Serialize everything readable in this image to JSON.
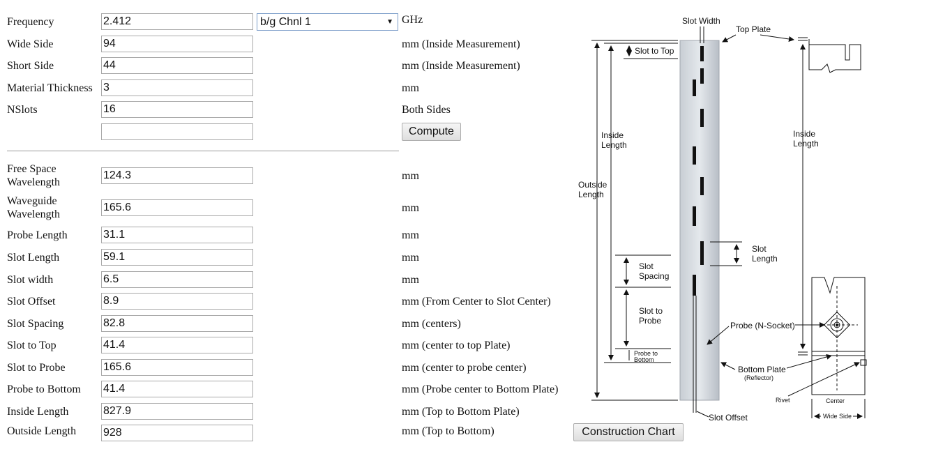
{
  "form": {
    "frequency": {
      "label": "Frequency",
      "value": "2.412",
      "unit": "GHz"
    },
    "channel_select": {
      "value": "b/g Chnl 1"
    },
    "wide_side": {
      "label": "Wide Side",
      "value": "94",
      "unit": "mm (Inside Measurement)"
    },
    "short_side": {
      "label": "Short Side",
      "value": "44",
      "unit": "mm (Inside Measurement)"
    },
    "material_thickness": {
      "label": "Material Thickness",
      "value": "3",
      "unit": "mm"
    },
    "nslots": {
      "label": "NSlots",
      "value": "16",
      "unit": "Both Sides"
    },
    "extra_field": {
      "value": ""
    },
    "compute_label": "Compute"
  },
  "results": [
    {
      "label_line1": "Free Space",
      "label_line2": "Wavelength",
      "value": "124.3",
      "unit": "mm"
    },
    {
      "label_line1": "Waveguide",
      "label_line2": "Wavelength",
      "value": "165.6",
      "unit": "mm"
    },
    {
      "label_line1": "Probe Length",
      "label_line2": "",
      "value": "31.1",
      "unit": "mm"
    },
    {
      "label_line1": "Slot Length",
      "label_line2": "",
      "value": "59.1",
      "unit": "mm"
    },
    {
      "label_line1": "Slot width",
      "label_line2": "",
      "value": "6.5",
      "unit": "mm"
    },
    {
      "label_line1": "Slot Offset",
      "label_line2": "",
      "value": "8.9",
      "unit": "mm (From Center to Slot Center)"
    },
    {
      "label_line1": "Slot Spacing",
      "label_line2": "",
      "value": "82.8",
      "unit": "mm (centers)"
    },
    {
      "label_line1": "Slot to Top",
      "label_line2": "",
      "value": "41.4",
      "unit": "mm (center to top Plate)"
    },
    {
      "label_line1": "Slot to Probe",
      "label_line2": "",
      "value": "165.6",
      "unit": "mm (center to probe center)"
    },
    {
      "label_line1": "Probe to Bottom",
      "label_line2": "",
      "value": "41.4",
      "unit": "mm (Probe center to Bottom Plate)"
    },
    {
      "label_line1": "Inside Length",
      "label_line2": "",
      "value": "827.9",
      "unit": "mm (Top to Bottom Plate)"
    },
    {
      "label_line1": "Outside Length",
      "label_line2": "",
      "value": "928",
      "unit": "mm (Top to Bottom)"
    }
  ],
  "diagram": {
    "slot_width": "Slot Width",
    "top_plate": "Top Plate",
    "slot_to_top": "Slot to Top",
    "inside_length_1": "Inside",
    "inside_length_2": "Length",
    "outside_length_1": "Outside",
    "outside_length_2": "Length",
    "slot_length_1": "Slot",
    "slot_length_2": "Length",
    "slot_spacing_1": "Slot",
    "slot_spacing_2": "Spacing",
    "slot_to_probe_1": "Slot to",
    "slot_to_probe_2": "Probe",
    "probe_to_bottom_1": "Probe to",
    "probe_to_bottom_2": "Bottom",
    "probe_socket": "Probe (N-Socket)",
    "bottom_plate": "Bottom Plate",
    "reflector": "(Reflector)",
    "rivet": "Rivet",
    "center": "Center",
    "wide_side": "Wide Side",
    "slot_offset": "Slot Offset"
  },
  "construction_chart_label": "Construction Chart"
}
